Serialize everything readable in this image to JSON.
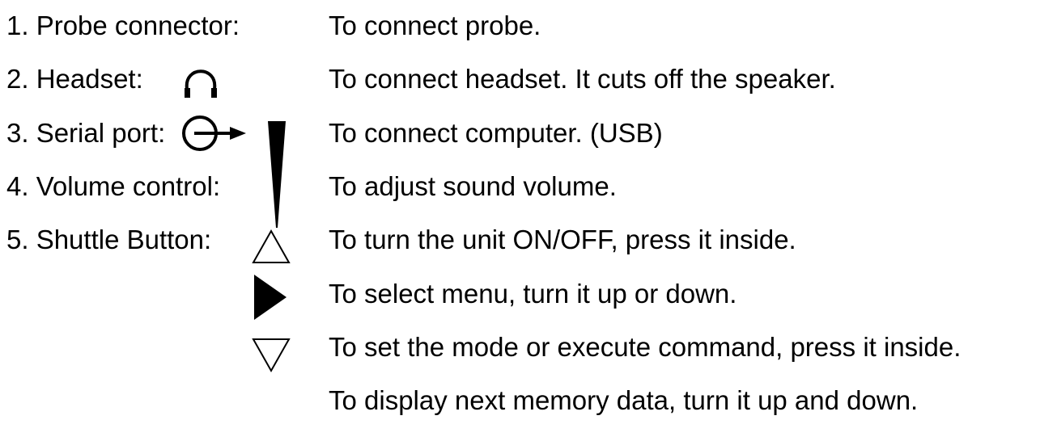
{
  "items": [
    {
      "label": "1. Probe connector:",
      "description": "To connect probe."
    },
    {
      "label": "2. Headset:",
      "icon": "headset-icon",
      "description": "To connect headset. It cuts off the speaker."
    },
    {
      "label": "3. Serial port:",
      "icon": "serial-port-icon",
      "description": "To connect computer. (USB)"
    },
    {
      "label": "4. Volume control:",
      "icon": "volume-wedge-icon",
      "description": "To adjust sound volume."
    },
    {
      "label": "5. Shuttle Button:",
      "icon": "triangle-up-outline-icon",
      "description": "To turn the unit ON/OFF, press it inside."
    }
  ],
  "shuttle_actions": [
    {
      "icon": "triangle-right-filled-icon",
      "description": "To select menu, turn it up or down."
    },
    {
      "icon": "triangle-down-outline-icon",
      "description": "To set the mode or execute command, press it inside."
    },
    {
      "description": "To display next memory data, turn it up and down."
    }
  ]
}
